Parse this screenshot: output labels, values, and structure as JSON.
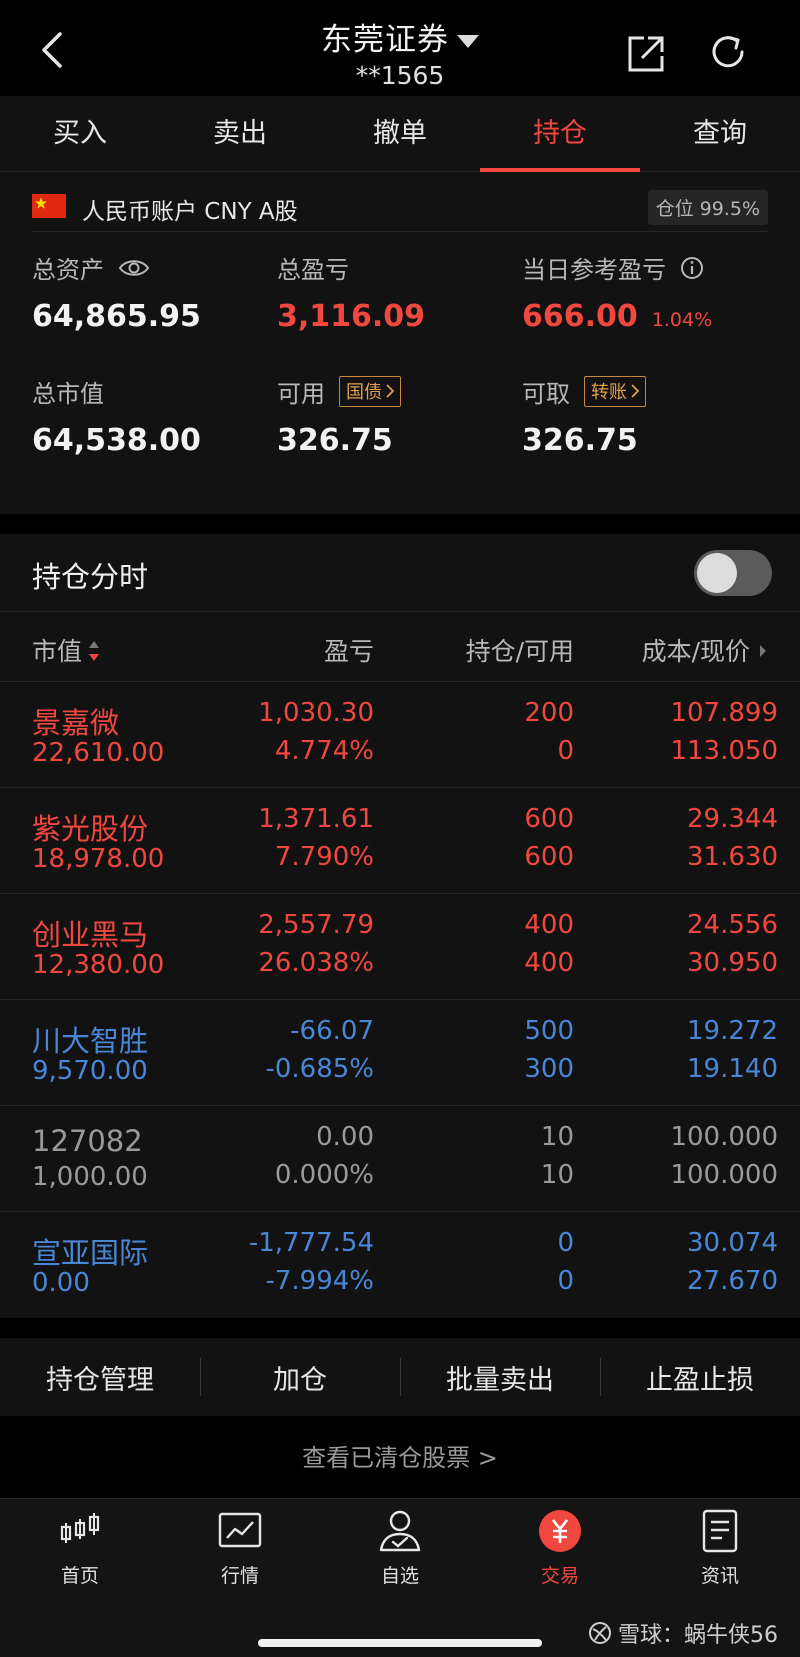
{
  "header": {
    "title": "东莞证券",
    "account_no": "**1565"
  },
  "tabs": [
    {
      "label": "买入"
    },
    {
      "label": "卖出"
    },
    {
      "label": "撤单"
    },
    {
      "label": "持仓",
      "active": true
    },
    {
      "label": "查询"
    }
  ],
  "account": {
    "label": "人民币账户 CNY A股",
    "position_ratio": "仓位 99.5%"
  },
  "metrics": {
    "total_assets_label": "总资产",
    "total_assets": "64,865.95",
    "total_pl_label": "总盈亏",
    "total_pl": "3,116.09",
    "daily_pl_label": "当日参考盈亏",
    "daily_pl": "666.00",
    "daily_pl_pct": "1.04%",
    "market_value_label": "总市值",
    "market_value": "64,538.00",
    "available_label": "可用",
    "available": "326.75",
    "available_tag": "国债",
    "withdrawable_label": "可取",
    "withdrawable": "326.75",
    "withdrawable_tag": "转账"
  },
  "timeshare": {
    "label": "持仓分时",
    "enabled": false
  },
  "table": {
    "headers": {
      "market_value": "市值",
      "pl": "盈亏",
      "holding": "持仓/可用",
      "cost": "成本/现价"
    },
    "rows": [
      {
        "name": "景嘉微",
        "market_value": "22,610.00",
        "pl": "1,030.30",
        "pl_pct": "4.774%",
        "holding": "200",
        "available": "0",
        "cost": "107.899",
        "price": "113.050",
        "color": "red"
      },
      {
        "name": "紫光股份",
        "market_value": "18,978.00",
        "pl": "1,371.61",
        "pl_pct": "7.790%",
        "holding": "600",
        "available": "600",
        "cost": "29.344",
        "price": "31.630",
        "color": "red"
      },
      {
        "name": "创业黑马",
        "market_value": "12,380.00",
        "pl": "2,557.79",
        "pl_pct": "26.038%",
        "holding": "400",
        "available": "400",
        "cost": "24.556",
        "price": "30.950",
        "color": "red"
      },
      {
        "name": "川大智胜",
        "market_value": "9,570.00",
        "pl": "-66.07",
        "pl_pct": "-0.685%",
        "holding": "500",
        "available": "300",
        "cost": "19.272",
        "price": "19.140",
        "color": "blue"
      },
      {
        "name": "127082",
        "market_value": "1,000.00",
        "pl": "0.00",
        "pl_pct": "0.000%",
        "holding": "10",
        "available": "10",
        "cost": "100.000",
        "price": "100.000",
        "color": "gray"
      },
      {
        "name": "宣亚国际",
        "market_value": "0.00",
        "pl": "-1,777.54",
        "pl_pct": "-7.994%",
        "holding": "0",
        "available": "0",
        "cost": "30.074",
        "price": "27.670",
        "color": "blue"
      }
    ]
  },
  "actions": [
    {
      "label": "持仓管理"
    },
    {
      "label": "加仓"
    },
    {
      "label": "批量卖出"
    },
    {
      "label": "止盈止损"
    }
  ],
  "cleared_link": "查看已清仓股票 >",
  "bottom_nav": [
    {
      "label": "首页",
      "icon": "candlestick-icon"
    },
    {
      "label": "行情",
      "icon": "chart-icon"
    },
    {
      "label": "自选",
      "icon": "user-check-icon"
    },
    {
      "label": "交易",
      "icon": "yuan-icon",
      "active": true
    },
    {
      "label": "资讯",
      "icon": "document-icon"
    }
  ],
  "watermark": "雪球：蜗牛侠56",
  "colors": {
    "up": "#f0473f",
    "down": "#4a86d6",
    "flat": "#9a9a9a",
    "tag": "#e0a050"
  }
}
